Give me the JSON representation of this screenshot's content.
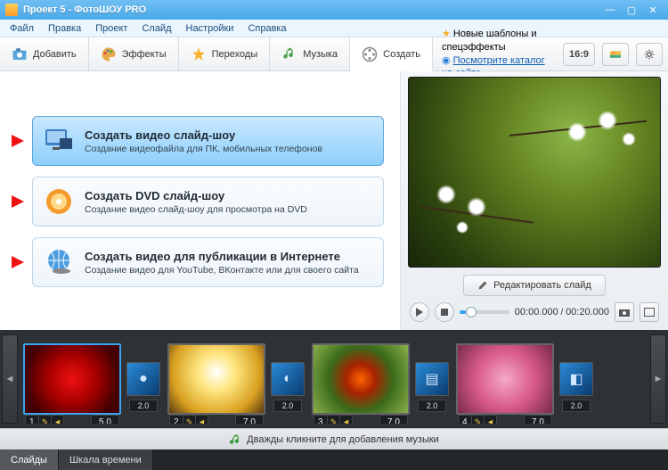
{
  "title": "Проект 5 - ФотоШОУ PRO",
  "menu": [
    "Файл",
    "Правка",
    "Проект",
    "Слайд",
    "Настройки",
    "Справка"
  ],
  "tabs": {
    "add": "Добавить",
    "effects": "Эффекты",
    "transitions": "Переходы",
    "music": "Музыка",
    "create": "Создать"
  },
  "promo": {
    "line1": "Новые шаблоны и спецэффекты",
    "link": "Посмотрите каталог на сайте..."
  },
  "aspect": "16:9",
  "create_options": [
    {
      "title": "Создать видео слайд-шоу",
      "sub": "Создание видеофайла для ПК, мобильных телефонов"
    },
    {
      "title": "Создать DVD слайд-шоу",
      "sub": "Создание видео слайд-шоу для просмотра на DVD"
    },
    {
      "title": "Создать видео для публикации в Интернете",
      "sub": "Создание видео для YouTube, ВКонтакте или для своего сайта"
    }
  ],
  "edit_slide": "Редактировать слайд",
  "time": {
    "current": "00:00.000",
    "total": "00:20.000"
  },
  "music_hint": "Дважды кликните для добавления музыки",
  "bottom": {
    "slides": "Слайды",
    "timeline": "Шкала времени"
  },
  "slides": [
    {
      "n": "1",
      "dur": "5.0",
      "tdur": "2.0"
    },
    {
      "n": "2",
      "dur": "7.0",
      "tdur": "2.0"
    },
    {
      "n": "3",
      "dur": "7.0",
      "tdur": "2.0"
    },
    {
      "n": "4",
      "dur": "7.0",
      "tdur": "2.0"
    }
  ]
}
